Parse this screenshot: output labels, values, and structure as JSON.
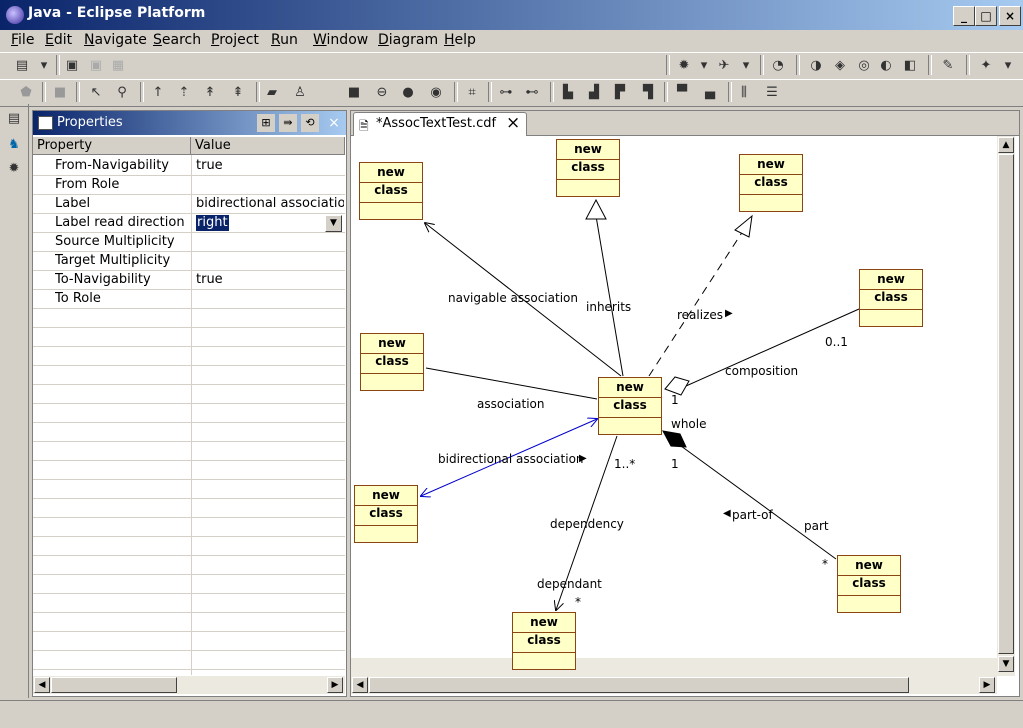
{
  "window": {
    "title": "Java - Eclipse Platform",
    "min": "_",
    "max": "□",
    "close": "×"
  },
  "menu": [
    "File",
    "Edit",
    "Navigate",
    "Search",
    "Project",
    "Run",
    "Window",
    "Diagram",
    "Help"
  ],
  "properties": {
    "title": "Properties",
    "close": "×",
    "col_property": "Property",
    "col_value": "Value",
    "rows": [
      {
        "name": "From-Navigability",
        "value": "true"
      },
      {
        "name": "From Role",
        "value": ""
      },
      {
        "name": "Label",
        "value": "bidirectional association"
      },
      {
        "name": "Label read direction",
        "value": "right"
      },
      {
        "name": "Source Multiplicity",
        "value": ""
      },
      {
        "name": "Target Multiplicity",
        "value": ""
      },
      {
        "name": "To-Navigability",
        "value": "true"
      },
      {
        "name": "To Role",
        "value": ""
      }
    ]
  },
  "editor": {
    "tab_label": "*AssocTextTest.cdf",
    "tab_close": "×",
    "class_name": "new class",
    "labels": {
      "navigable": "navigable association",
      "inherits": "inherits",
      "realizes": "realizes",
      "composition": "composition",
      "zero_one": "0..1",
      "one_a": "1",
      "whole": "whole",
      "one_b": "1",
      "association": "association",
      "bidirectional": "bidirectional association",
      "one_many": "1..*",
      "dependency": "dependency",
      "dependant": "dependant",
      "star_a": "*",
      "part_of": "part-of",
      "part": "part",
      "star_b": "*"
    }
  },
  "colors": {
    "title_start": "#0a246a",
    "title_end": "#a6caf0",
    "class_fill": "#ffffc8",
    "selection": "#0a246a"
  }
}
